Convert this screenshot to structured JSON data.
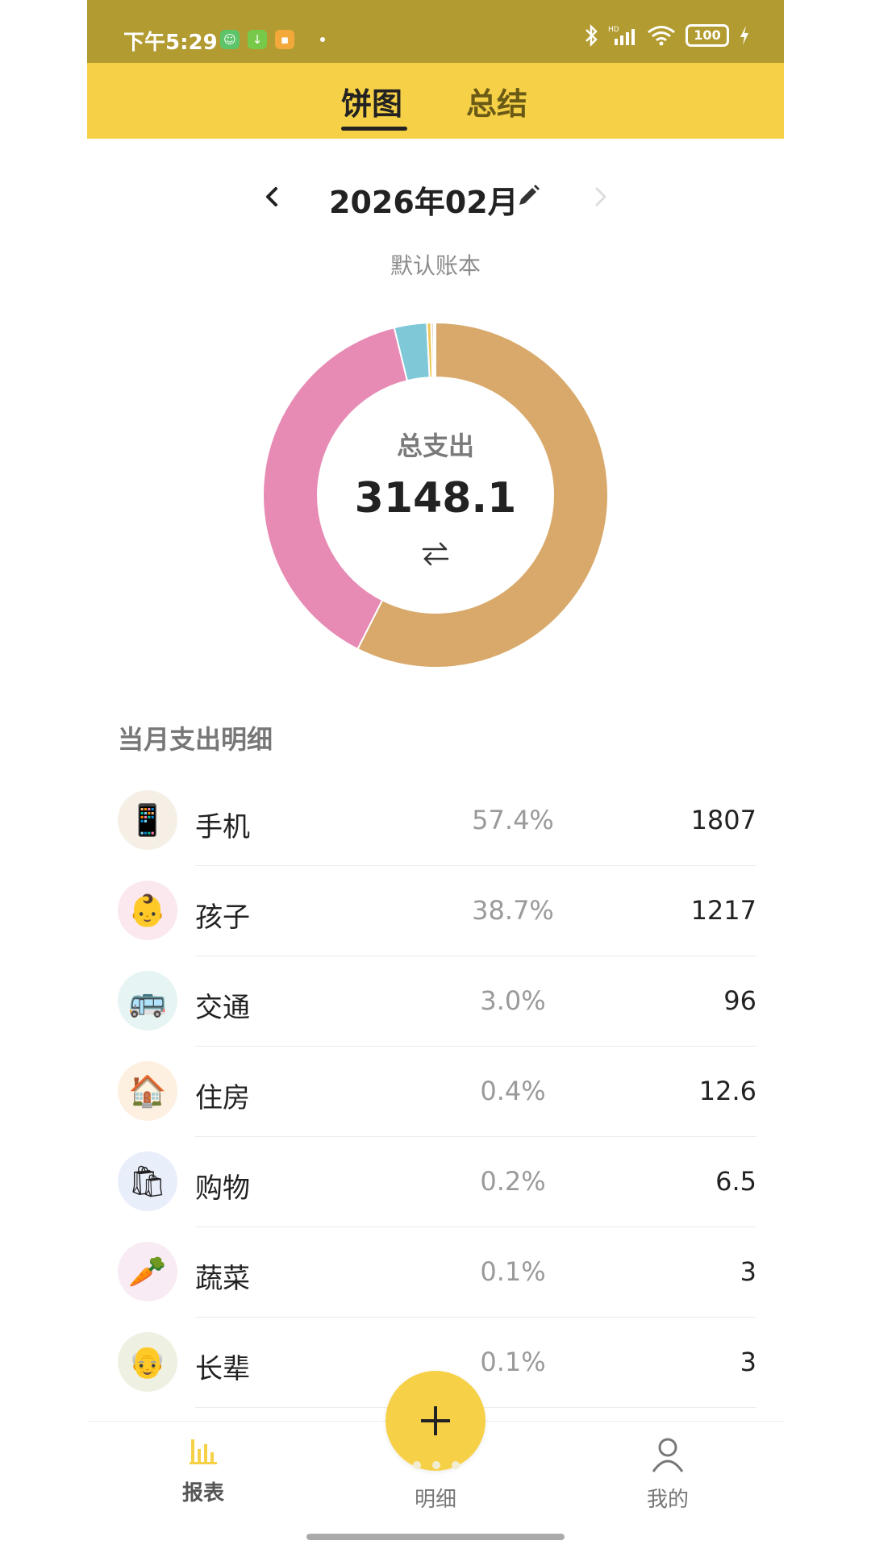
{
  "status_bar": {
    "time": "下午5:29",
    "battery": "100",
    "icons": [
      "robot-app-icon",
      "download-app-icon",
      "message-app-icon",
      "bluetooth-icon",
      "signal-icon",
      "wifi-icon",
      "battery-icon",
      "charging-icon"
    ],
    "hd_label": "HD"
  },
  "header": {
    "tabs": [
      {
        "label": "饼图",
        "active": true
      },
      {
        "label": "总结",
        "active": false
      }
    ]
  },
  "month_nav": {
    "month": "2026年02月"
  },
  "ledger": "默认账本",
  "chart_data": {
    "type": "pie",
    "title": "总支出",
    "total": "3148.1",
    "categories": [
      "手机",
      "孩子",
      "交通",
      "住房",
      "购物",
      "蔬菜",
      "长辈"
    ],
    "values": [
      1807,
      1217,
      96,
      12.6,
      6.5,
      3,
      3
    ],
    "colors": [
      "#d8a96b",
      "#e78bb4",
      "#7ec8d8",
      "#f0c85a",
      "#cbb79a",
      "#f2a65a",
      "#c9d3a0"
    ]
  },
  "list": {
    "title": "当月支出明细",
    "rows": [
      {
        "name": "手机",
        "pct": "57.4%",
        "amount": "1807",
        "icon": "📱",
        "icon_name": "phone-icon",
        "bg": "#f5efe6"
      },
      {
        "name": "孩子",
        "pct": "38.7%",
        "amount": "1217",
        "icon": "👶",
        "icon_name": "baby-icon",
        "bg": "#fbe8ee"
      },
      {
        "name": "交通",
        "pct": "3.0%",
        "amount": "96",
        "icon": "🚌",
        "icon_name": "bus-icon",
        "bg": "#e6f4f3"
      },
      {
        "name": "住房",
        "pct": "0.4%",
        "amount": "12.6",
        "icon": "🏠",
        "icon_name": "house-icon",
        "bg": "#fdf0e0"
      },
      {
        "name": "购物",
        "pct": "0.2%",
        "amount": "6.5",
        "icon": "🛍",
        "icon_name": "shopping-bag-icon",
        "bg": "#e9eefb"
      },
      {
        "name": "蔬菜",
        "pct": "0.1%",
        "amount": "3",
        "icon": "🥕",
        "icon_name": "carrot-icon",
        "bg": "#f8ebf4"
      },
      {
        "name": "长辈",
        "pct": "0.1%",
        "amount": "3",
        "icon": "👴",
        "icon_name": "elder-icon",
        "bg": "#eef1e2"
      }
    ]
  },
  "bottom_nav": {
    "report": "报表",
    "detail": "明细",
    "mine": "我的"
  }
}
